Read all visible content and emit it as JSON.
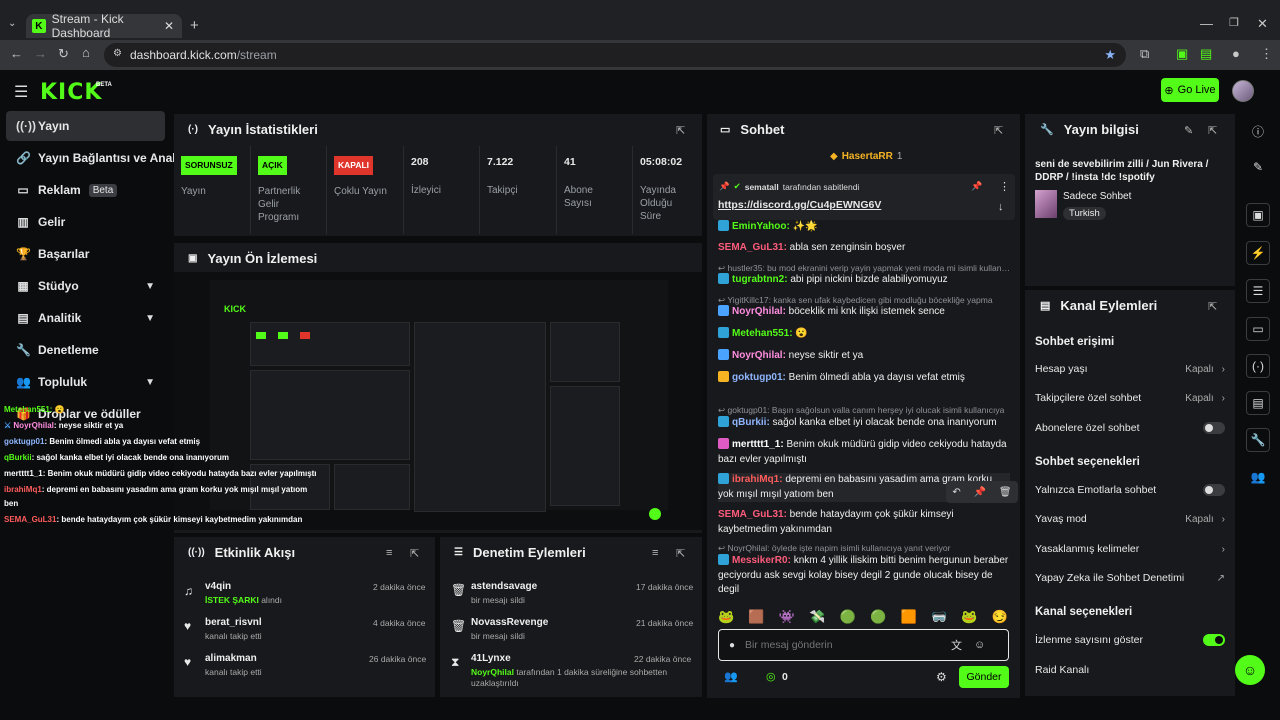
{
  "browser": {
    "tab_title": "Stream - Kick Dashboard",
    "url_host": "dashboard.kick.com",
    "url_path": "/stream"
  },
  "header": {
    "logo": "KICK",
    "logo_sup": "BETA",
    "go_live": "Go Live"
  },
  "sidebar": {
    "items": [
      {
        "label": "Yayın"
      },
      {
        "label": "Yayın Bağlantısı ve Anahtar"
      },
      {
        "label": "Reklam",
        "badge": "Beta"
      },
      {
        "label": "Gelir"
      },
      {
        "label": "Başarılar"
      },
      {
        "label": "Stüdyo"
      },
      {
        "label": "Analitik"
      },
      {
        "label": "Denetleme"
      },
      {
        "label": "Topluluk"
      },
      {
        "label": "Droplar ve ödüller"
      }
    ]
  },
  "stats": {
    "title": "Yayın İstatistikleri",
    "items": [
      {
        "badge": "SORUNSUZ",
        "label": "Yayın",
        "color": "#53fc18"
      },
      {
        "badge": "AÇIK",
        "label": "Partnerlik Gelir Programı",
        "color": "#53fc18"
      },
      {
        "badge": "KAPALI",
        "label": "Çoklu Yayın",
        "color": "#e0352b"
      },
      {
        "value": "208",
        "label": "İzleyici"
      },
      {
        "value": "7.122",
        "label": "Takipçi"
      },
      {
        "value": "41",
        "label": "Abone Sayısı"
      },
      {
        "value": "05:08:02",
        "label": "Yayında Olduğu Süre"
      }
    ]
  },
  "preview": {
    "title": "Yayın Ön İzlemesi",
    "overlay": [
      {
        "user": "Metehan551:",
        "text": " 😮",
        "color": "#53fc18"
      },
      {
        "user": "NoyrQhilal",
        "text": ": neyse siktir et ya",
        "color": "#ff8de0"
      },
      {
        "user": "goktugp01",
        "text": ": Benim ölmedi abla ya dayısı vefat etmiş",
        "color": "#8fb6ff"
      },
      {
        "user": "qBurkii",
        "text": ": sağol kanka elbet iyi olacak bende ona inanıyorum",
        "color": "#53fc18"
      },
      {
        "user": "mertttt1_1",
        "text": ": Benim okuk müdürü gidip video cekiyodu hatayda bazı evler yapılmıştı",
        "color": "#ffffff"
      },
      {
        "user": "ibrahiMq1",
        "text": ": depremi en babasını yasadım ama gram korku yok mışıl mışıl yatıom",
        "color": "#ff5c5c"
      },
      {
        "user": "",
        "text": "ben",
        "color": "#ffffff"
      },
      {
        "user": "SEMA_GuL31",
        "text": ": bende hataydayım çok şükür kimseyi kaybetmedim yakınımdan",
        "color": "#ff5c5c"
      }
    ]
  },
  "activity": {
    "title": "Etkinlik Akışı",
    "items": [
      {
        "name": "v4qin",
        "highlight": "İSTEK ŞARKI",
        "sub": " alındı",
        "time": "2 dakika önce",
        "icon": "song-request-icon"
      },
      {
        "name": "berat_risvnl",
        "sub": "kanalı takip etti",
        "time": "4 dakika önce",
        "icon": "heart-icon"
      },
      {
        "name": "alimakman",
        "sub": "kanalı takip etti",
        "time": "26 dakika önce",
        "icon": "heart-icon"
      }
    ]
  },
  "moderation": {
    "title": "Denetim Eylemleri",
    "items": [
      {
        "name": "astendsavage",
        "sub": "bir mesajı sildi",
        "time": "17 dakika önce"
      },
      {
        "name": "NovassRevenge",
        "sub": "bir mesajı sildi",
        "time": "21 dakika önce"
      },
      {
        "name": "41Lynxe",
        "sub_user": "NoyrQhilal",
        "sub": " tarafından 1 dakika süreliğine sohbetten uzaklaştırıldı",
        "time": "22 dakika önce"
      }
    ]
  },
  "chat": {
    "title": "Sohbet",
    "top_gifter": "HasertaRR",
    "top_gifter_count": "1",
    "pinned_by_user": "sematall",
    "pinned_by_text": " tarafından sabitlendi",
    "pinned_link": "https://discord.gg/Cu4pEWNG6V",
    "messages": [
      {
        "user": "EminYahoo:",
        "text": " ✨🌟",
        "color": "#53fc18"
      },
      {
        "user": "SEMA_GuL31:",
        "text": " abla sen zenginsin boşver",
        "color": "#ff5c7c"
      },
      {
        "reply": "hustler35: bu mod ekranini verip yayin yapmak yeni moda mi isimli kullanıcıya yanıt"
      },
      {
        "user": "tugrabtnn2:",
        "text": " abi pipi nickini bizde alabiliyomuyuz",
        "color": "#53fc18"
      },
      {
        "reply": "YigitKillc17: kanka sen ufak kaybedicen gibi modluğu böcekliğe yapma"
      },
      {
        "user": "NoyrQhilal:",
        "text": " böceklik mi knk ilişki istemek sence",
        "color": "#ff8de0"
      },
      {
        "user": "Metehan551:",
        "text": " 😮",
        "color": "#53fc18"
      },
      {
        "user": "NoyrQhilal:",
        "text": " neyse siktir et ya",
        "color": "#ff8de0"
      },
      {
        "user": "goktugp01:",
        "text": " Benim ölmedi abla ya dayısı vefat etmiş",
        "color": "#8fb6ff"
      },
      {
        "reply": "goktugp01: Başın sağolsun valla canım herşey iyi olucak isimli kullanıcıya"
      },
      {
        "user": "qBurkii:",
        "text": " sağol kanka elbet iyi olacak bende ona inanıyorum",
        "color": "#8fb6ff"
      },
      {
        "user": "mertttt1_1:",
        "text": " Benim okuk müdürü gidip video cekiyodu hatayda bazı evler yapılmıştı",
        "color": "#ffffff"
      },
      {
        "user": "ibrahiMq1:",
        "text": " depremi en babasını yasadım ama gram korku yok mışıl mışıl yatıom ben",
        "color": "#ff5c5c"
      },
      {
        "user": "SEMA_GuL31:",
        "text": " bende hataydayım çok şükür kimseyi kaybetmedim yakınımdan",
        "color": "#ff5c7c"
      },
      {
        "reply": "NoyrQhilal: öylede işte napim isimli kullanıcıya yanıt veriyor"
      },
      {
        "user": "MessikerR0:",
        "text": " knkm 4 yillik iliskim bitti benim hergunun beraber geciyordu ask sevgi kolay bisey degil 2 gunde olucak bisey de degil",
        "color": "#ff5c7c"
      }
    ],
    "input_placeholder": "Bir mesaj gönderin",
    "points": "0",
    "send": "Gönder"
  },
  "streaminfo": {
    "title": "Yayın bilgisi",
    "stream_title": "seni de sevebilirim zilli / Jun Rivera / DDRP / !insta !dc !spotify",
    "category": "Sadece Sohbet",
    "tag": "Turkish"
  },
  "channel_actions": {
    "title": "Kanal Eylemleri",
    "chat_access": "Sohbet erişimi",
    "rows1": [
      {
        "label": "Hesap yaşı",
        "value": "Kapalı",
        "kind": "chevron"
      },
      {
        "label": "Takipçilere özel sohbet",
        "value": "Kapalı",
        "kind": "chevron"
      },
      {
        "label": "Abonelere özel sohbet",
        "kind": "toggle-off"
      }
    ],
    "chat_options": "Sohbet seçenekleri",
    "rows2": [
      {
        "label": "Yalnızca Emotlarla sohbet",
        "kind": "toggle-off"
      },
      {
        "label": "Yavaş mod",
        "value": "Kapalı",
        "kind": "chevron"
      },
      {
        "label": "Yasaklanmış kelimeler",
        "kind": "chevron"
      },
      {
        "label": "Yapay Zeka ile Sohbet Denetimi",
        "kind": "external"
      }
    ],
    "channel_options": "Kanal seçenekleri",
    "rows3": [
      {
        "label": "İzlenme sayısını göster",
        "kind": "toggle-on"
      },
      {
        "label": "Raid Kanalı",
        "kind": "none"
      }
    ]
  },
  "colors": {
    "accent": "#53fc18",
    "panel": "#18191c",
    "bg": "#0b0c0e",
    "danger": "#e0352b"
  }
}
